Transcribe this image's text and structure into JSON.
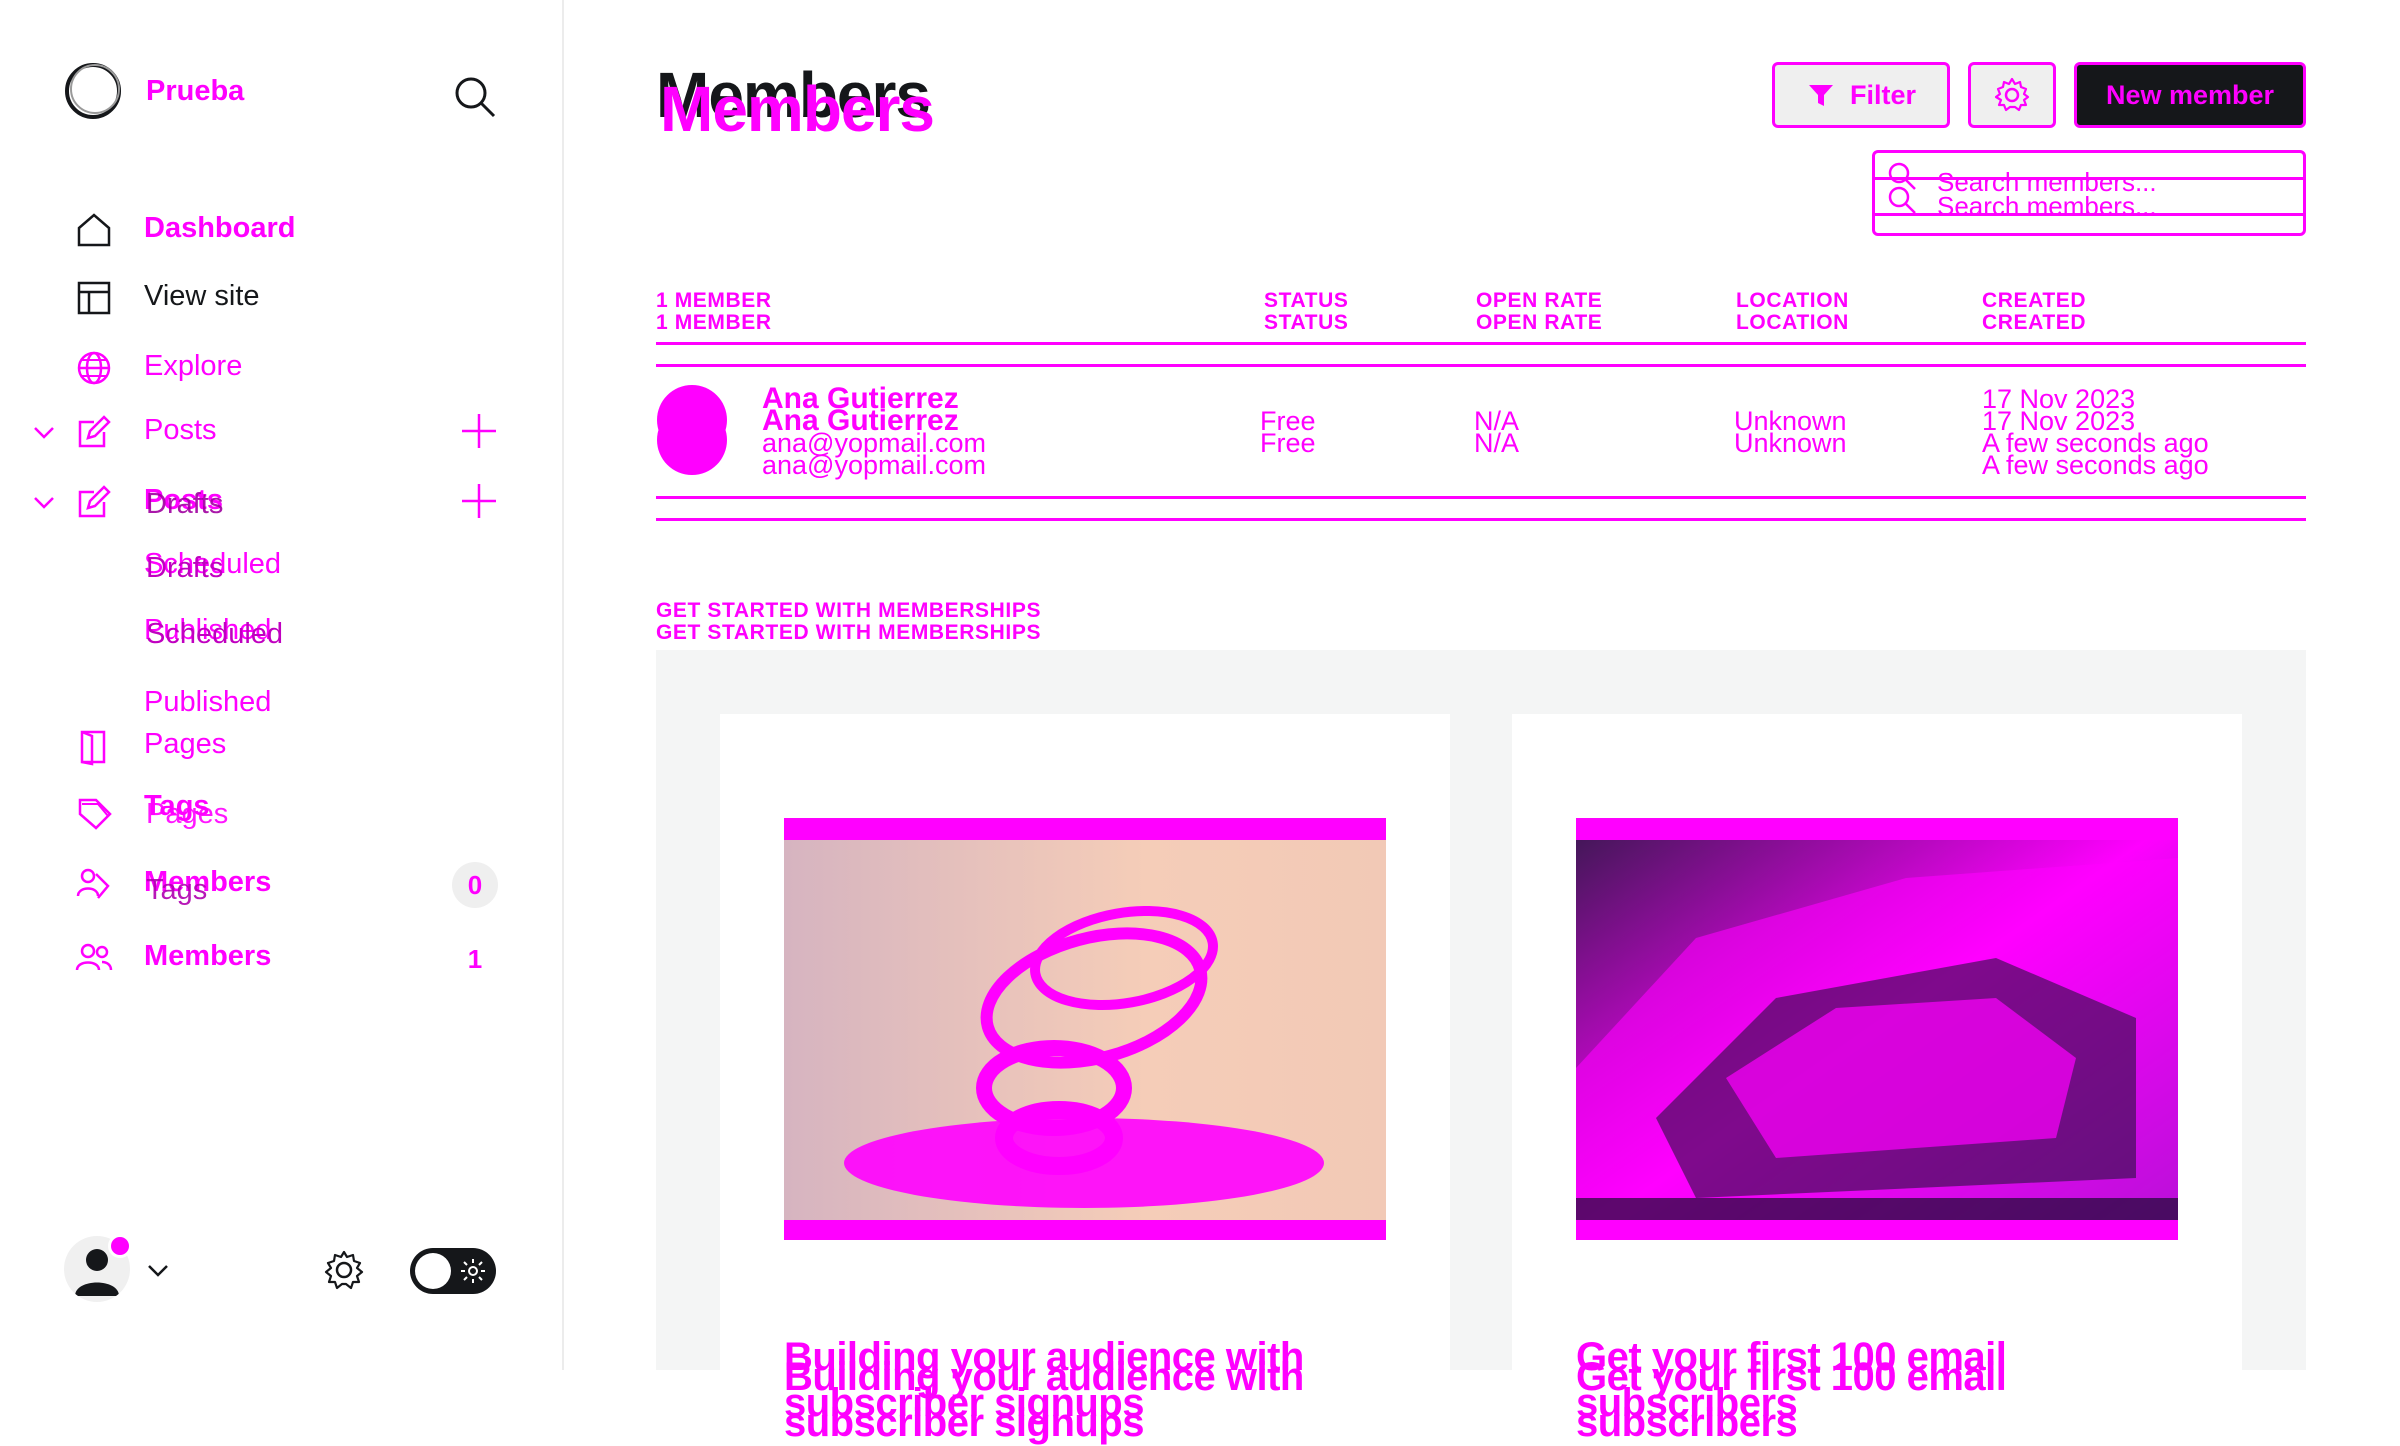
{
  "app": {
    "site_name": "Prueba"
  },
  "sidebar": {
    "items": [
      {
        "label": "Dashboard"
      },
      {
        "label": "View site"
      },
      {
        "label": "Explore"
      },
      {
        "label": "Posts"
      },
      {
        "label": "Posts"
      },
      {
        "label": "Drafts"
      },
      {
        "label": "Scheduled"
      },
      {
        "label": "Drafts"
      },
      {
        "label": "Published"
      },
      {
        "label": "Scheduled"
      },
      {
        "label": "Published"
      },
      {
        "label": "Pages"
      },
      {
        "label": "Pages"
      },
      {
        "label": "Tags"
      },
      {
        "label": "Tags"
      },
      {
        "label": "Members"
      },
      {
        "label": "Members"
      }
    ],
    "members_count_a": "0",
    "members_count_b": "1"
  },
  "header": {
    "title": "Members",
    "filter_label": "Filter",
    "new_member_label": "New member",
    "search_placeholder": "Search members..."
  },
  "table": {
    "headers": [
      "1 MEMBER",
      "STATUS",
      "OPEN RATE",
      "LOCATION",
      "CREATED"
    ],
    "rows": [
      {
        "name": "Ana Gutierrez",
        "email": "ana@yopmail.com",
        "status": "Free",
        "open_rate": "N/A",
        "location": "Unknown",
        "created_date": "17 Nov 2023",
        "created_relative": "A few seconds ago"
      }
    ]
  },
  "get_started": {
    "title": "GET STARTED WITH MEMBERSHIPS",
    "cards": [
      {
        "title": "Building your audience with subscriber signups"
      },
      {
        "title": "Get your first 100 email subscribers"
      }
    ]
  },
  "colors": {
    "accent": "#ff00ff",
    "dark": "#15171a"
  }
}
